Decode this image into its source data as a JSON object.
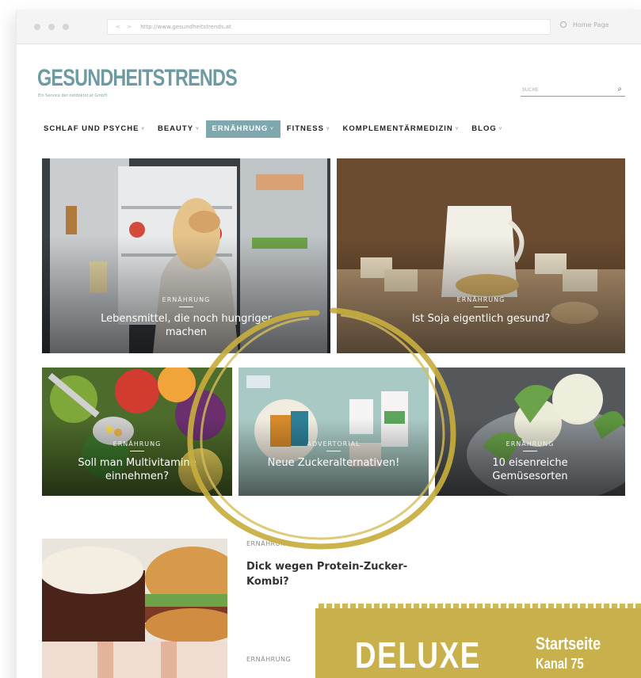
{
  "browser": {
    "url": "http://www.gesundheitstrends.at",
    "nav_arrows": "< >",
    "home_label": "Home Page"
  },
  "site": {
    "logo": "GESUNDHEITSTRENDS",
    "tagline": "Ein Service der netdoktor.at GmbH",
    "search_placeholder": "SUCHE"
  },
  "menu": [
    {
      "label": "SCHLAF UND PSYCHE",
      "active": false
    },
    {
      "label": "BEAUTY",
      "active": false
    },
    {
      "label": "ERNÄHRUNG",
      "active": true
    },
    {
      "label": "FITNESS",
      "active": false
    },
    {
      "label": "KOMPLEMENTÄRMEDIZIN",
      "active": false
    },
    {
      "label": "BLOG",
      "active": false
    }
  ],
  "featured": [
    {
      "category": "ERNÄHRUNG",
      "title_line1": "Lebensmittel, die noch hungriger",
      "title_line2": "machen"
    },
    {
      "category": "ERNÄHRUNG",
      "title_line1": "Ist Soja eigentlich gesund?",
      "title_line2": ""
    },
    {
      "category": "ERNÄHRUNG",
      "title_line1": "Soll man Multivitamine",
      "title_line2": "einnehmen?"
    },
    {
      "category": "ADVERTORIAL",
      "title_line1": "Neue Zuckeralternativen!",
      "title_line2": ""
    },
    {
      "category": "ERNÄHRUNG",
      "title_line1": "10 eisenreiche",
      "title_line2": "Gemüsesorten"
    }
  ],
  "list": [
    {
      "category": "ERNÄHRUNG",
      "title_line1": "Dick wegen Protein-Zucker-",
      "title_line2": "Kombi?"
    },
    {
      "category": "ERNÄHRUNG",
      "title_line1": "",
      "title_line2": ""
    }
  ],
  "badge": {
    "big": "DELUXE",
    "line1": "Startseite",
    "line2": "Kanal 75"
  },
  "colors": {
    "accent": "#7fa8ae",
    "logo": "#6f9aa1",
    "gold": "#c8b04c"
  }
}
